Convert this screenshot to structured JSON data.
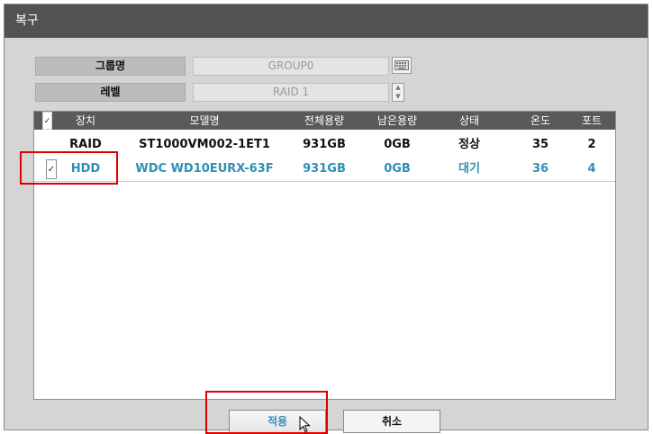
{
  "window": {
    "title": "복구"
  },
  "form": {
    "group_label": "그룹명",
    "group_value": "GROUP0",
    "level_label": "레벨",
    "level_value": "RAID 1"
  },
  "table": {
    "headers": [
      "장치",
      "모델명",
      "전체용량",
      "남은용량",
      "상태",
      "온도",
      "포트"
    ],
    "rows": [
      {
        "checked": false,
        "device": "RAID",
        "model": "ST1000VM002-1ET1",
        "total": "931GB",
        "free": "0GB",
        "status": "정상",
        "temp": "35",
        "port": "2"
      },
      {
        "checked": true,
        "device": "HDD",
        "model": "WDC WD10EURX-63F",
        "total": "931GB",
        "free": "0GB",
        "status": "대기",
        "temp": "36",
        "port": "4"
      }
    ]
  },
  "buttons": {
    "apply": "적용",
    "cancel": "취소"
  },
  "colors": {
    "titlebar": "#525252",
    "highlight_text": "#2e8fb7",
    "annotation": "#e00000"
  },
  "icons": [
    "keyboard-icon",
    "spin-up-icon",
    "spin-down-icon",
    "checkbox-icon",
    "cursor-arrow-icon"
  ]
}
